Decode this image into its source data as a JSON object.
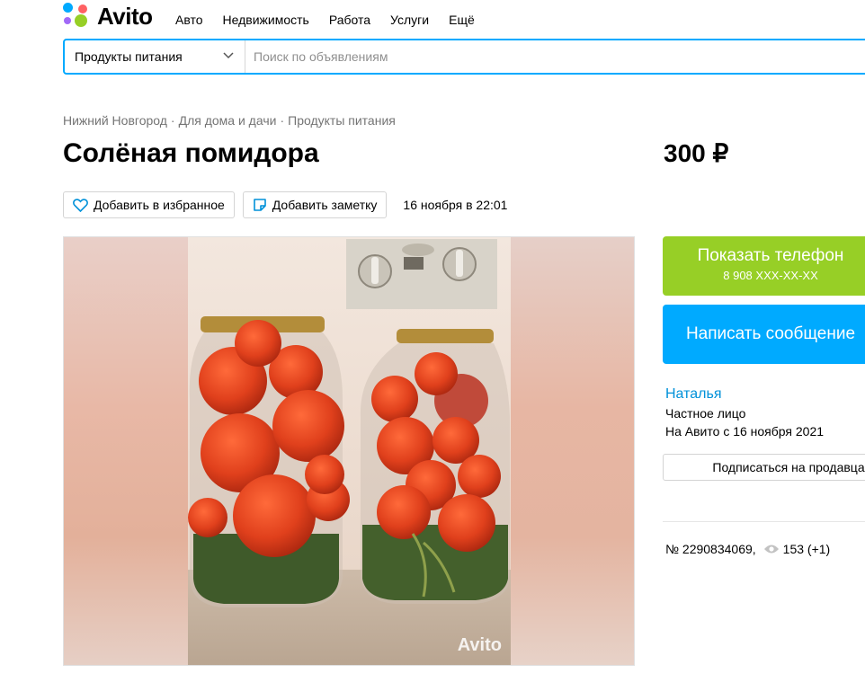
{
  "header": {
    "logo_text": "Avito",
    "nav": [
      "Авто",
      "Недвижимость",
      "Работа",
      "Услуги",
      "Ещё"
    ]
  },
  "search": {
    "category": "Продукты питания",
    "placeholder": "Поиск по объявлениям"
  },
  "breadcrumbs": [
    "Нижний Новгород",
    "Для дома и дачи",
    "Продукты питания"
  ],
  "listing": {
    "title": "Солёная помидора",
    "price": "300 ₽",
    "favorite_label": "Добавить в избранное",
    "note_label": "Добавить заметку",
    "date": "16 ноября в 22:01",
    "watermark": "Avito"
  },
  "contact": {
    "show_phone_label": "Показать телефон",
    "phone_masked": "8 908 XXX-XX-XX",
    "write_message_label": "Написать сообщение"
  },
  "seller": {
    "name": "Наталья",
    "type": "Частное лицо",
    "since": "На Авито с 16 ноября 2021",
    "subscribe_label": "Подписаться на продавца"
  },
  "meta": {
    "ad_number": "№ 2290834069,",
    "views": "153 (+1)"
  },
  "colors": {
    "accent_blue": "#00AAFF",
    "accent_green": "#97CF26",
    "link_blue": "#0091d9"
  }
}
